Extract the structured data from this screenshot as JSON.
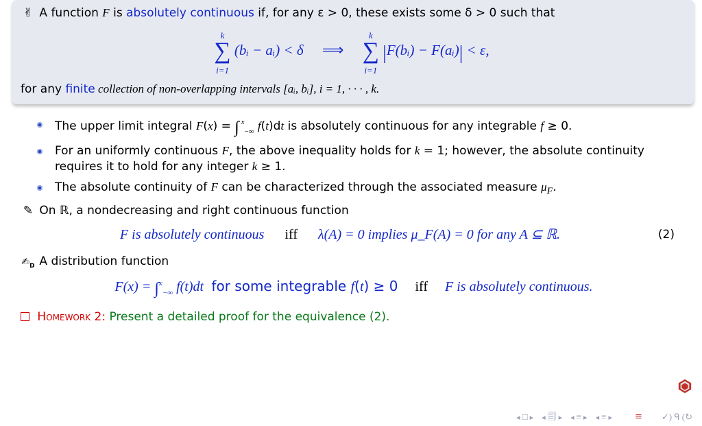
{
  "def": {
    "intro_before_F": "A function ",
    "F": "F",
    "intro_after_F": " is ",
    "abs_cont": "absolutely continuous",
    "intro_tail": " if, for any ε > 0, these exists some δ > 0 such that",
    "sum_upper": "k",
    "sum_lower": "i=1",
    "lhs_body": "(bᵢ − aᵢ) < δ",
    "implies": "⟹",
    "rhs_body": "F(bᵢ) − F(aᵢ)",
    "rhs_tail": " < ε,",
    "closing_pre": "for any ",
    "finite": "finite",
    "closing_post": " collection of non-overlapping intervals [aᵢ, bᵢ], i = 1, · · · , k."
  },
  "bullets": [
    "The upper limit integral F(x) = ∫ f(t)dt (from −∞ to x) is absolutely continuous for any integrable f ≥ 0.",
    "For an uniformly continuous F, the above inequality holds for k = 1; however, the absolute continuity requires it to hold for any integer k ≥ 1.",
    "The absolute continuity of F can be characterized through the associated measure μ_F."
  ],
  "line_R": {
    "prefix": "On ",
    "R": "ℝ",
    "suffix": ", a nondecreasing and right continuous function"
  },
  "eq2": {
    "left": "F is absolutely continuous",
    "iff": "iff",
    "right": "λ(A) = 0 implies μ_F(A) = 0 for any A ⊆ ℝ.",
    "tag": "(2)"
  },
  "dist_heading": "A distribution function",
  "eq3": {
    "lhs_pre": "F(x) = ",
    "int_low": "−∞",
    "int_up": "x",
    "lhs_post": " f(t)dt ",
    "mid": "for some integrable f(t) ≥ 0",
    "iff": "iff",
    "rhs": "F is absolutely continuous."
  },
  "hw": {
    "label": "Homework",
    "num": " 2: ",
    "text": "Present a detailed proof for the equivalence (2)."
  },
  "nav": {
    "sym_sq": "□",
    "sym_doc": "🗐",
    "sym_bar": "≡",
    "back_link": "≡"
  }
}
